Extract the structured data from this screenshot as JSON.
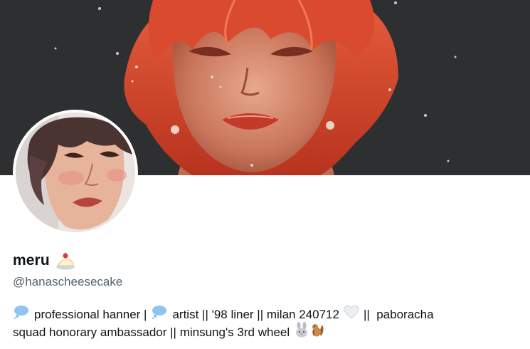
{
  "profile": {
    "display_name": "meru",
    "name_emoji": "shortcake-emoji",
    "handle": "@hanascheesecake",
    "bio": {
      "line1": {
        "emoji_1": "thought-balloon-emoji",
        "text_1": "professional hanner |",
        "emoji_2": "thought-balloon-emoji",
        "text_2": "artist || '98 liner || milan 240712",
        "emoji_3": "white-heart-emoji",
        "text_3": "||  paboracha"
      },
      "line2": {
        "text_1": "squad honorary ambassador || minsung's 3rd wheel",
        "emoji_1": "rabbit-emoji",
        "emoji_2": "chipmunk-emoji"
      }
    }
  },
  "colors": {
    "banner_bg": "#2e2f31",
    "hair": "#d2452c",
    "skin": "#e0a487",
    "text_primary": "#0f1419",
    "text_secondary": "#536471",
    "thought_bubble": "#8ec4ef"
  }
}
